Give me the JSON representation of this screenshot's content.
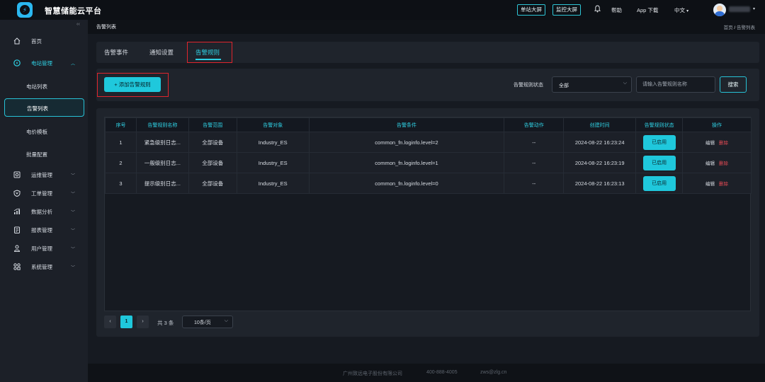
{
  "app": {
    "title": "智慧储能云平台"
  },
  "topbar": {
    "single_screen": "单站大屏",
    "monitor_screen": "监控大屏",
    "help": "帮助",
    "app_download": "App 下载",
    "language": "中文",
    "language_caret": "▾",
    "user_caret": "▾"
  },
  "sidebar": {
    "collapse_glyph": "‹‹",
    "items": [
      {
        "label": "首页",
        "icon": "home-icon"
      },
      {
        "label": "电站管理",
        "icon": "station-icon",
        "chevron": "︿"
      },
      {
        "label": "运维管理",
        "icon": "maintenance-icon",
        "chevron": "﹀"
      },
      {
        "label": "工单管理",
        "icon": "workorder-icon",
        "chevron": "﹀"
      },
      {
        "label": "数据分析",
        "icon": "analytics-icon",
        "chevron": "﹀"
      },
      {
        "label": "报表管理",
        "icon": "report-icon",
        "chevron": "﹀"
      },
      {
        "label": "用户管理",
        "icon": "user-icon",
        "chevron": "﹀"
      },
      {
        "label": "系统管理",
        "icon": "system-icon",
        "chevron": "﹀"
      }
    ],
    "sub_items": [
      "电站列表",
      "告警列表",
      "电价模板",
      "批量配置"
    ]
  },
  "breadcrumb": {
    "page": "告警列表",
    "home": "首页",
    "sep": "/",
    "current": "告警列表"
  },
  "tabs": [
    "告警事件",
    "通知设置",
    "告警规则"
  ],
  "toolbar": {
    "add_label": "+ 添加告警规则",
    "status_label": "告警规则状态",
    "status_value": "全部",
    "status_caret": "⌵",
    "search_placeholder": "请输入告警规则名称",
    "search_button": "搜索"
  },
  "table": {
    "headers": [
      "序号",
      "告警规则名称",
      "告警范围",
      "告警对象",
      "告警条件",
      "告警动作",
      "创建时间",
      "告警规则状态",
      "操作"
    ],
    "rows": [
      {
        "no": "1",
        "name": "紧急级别日志...",
        "scope": "全部设备",
        "target": "Industry_ES",
        "condition": "common_fn.loginfo.level=2",
        "action": "--",
        "time": "2024-08-22 16:23:24",
        "status": "已启用",
        "edit": "编辑",
        "delete": "删除"
      },
      {
        "no": "2",
        "name": "一般级别日志...",
        "scope": "全部设备",
        "target": "Industry_ES",
        "condition": "common_fn.loginfo.level=1",
        "action": "--",
        "time": "2024-08-22 16:23:19",
        "status": "已启用",
        "edit": "编辑",
        "delete": "删除"
      },
      {
        "no": "3",
        "name": "提示级别日志...",
        "scope": "全部设备",
        "target": "Industry_ES",
        "condition": "common_fn.loginfo.level=0",
        "action": "--",
        "time": "2024-08-22 16:23:13",
        "status": "已启用",
        "edit": "编辑",
        "delete": "删除"
      }
    ]
  },
  "pagination": {
    "prev": "‹",
    "current": "1",
    "next": "›",
    "total": "共 3 条",
    "page_size": "10条/页",
    "size_caret": "⌵"
  },
  "footer": {
    "company": "广州致远电子股份有限公司",
    "phone": "400-888-4005",
    "email": "zws@zlg.cn"
  },
  "colors": {
    "accent": "#1fc8dc",
    "danger": "#e84b55",
    "highlight_box": "#e0252d"
  }
}
